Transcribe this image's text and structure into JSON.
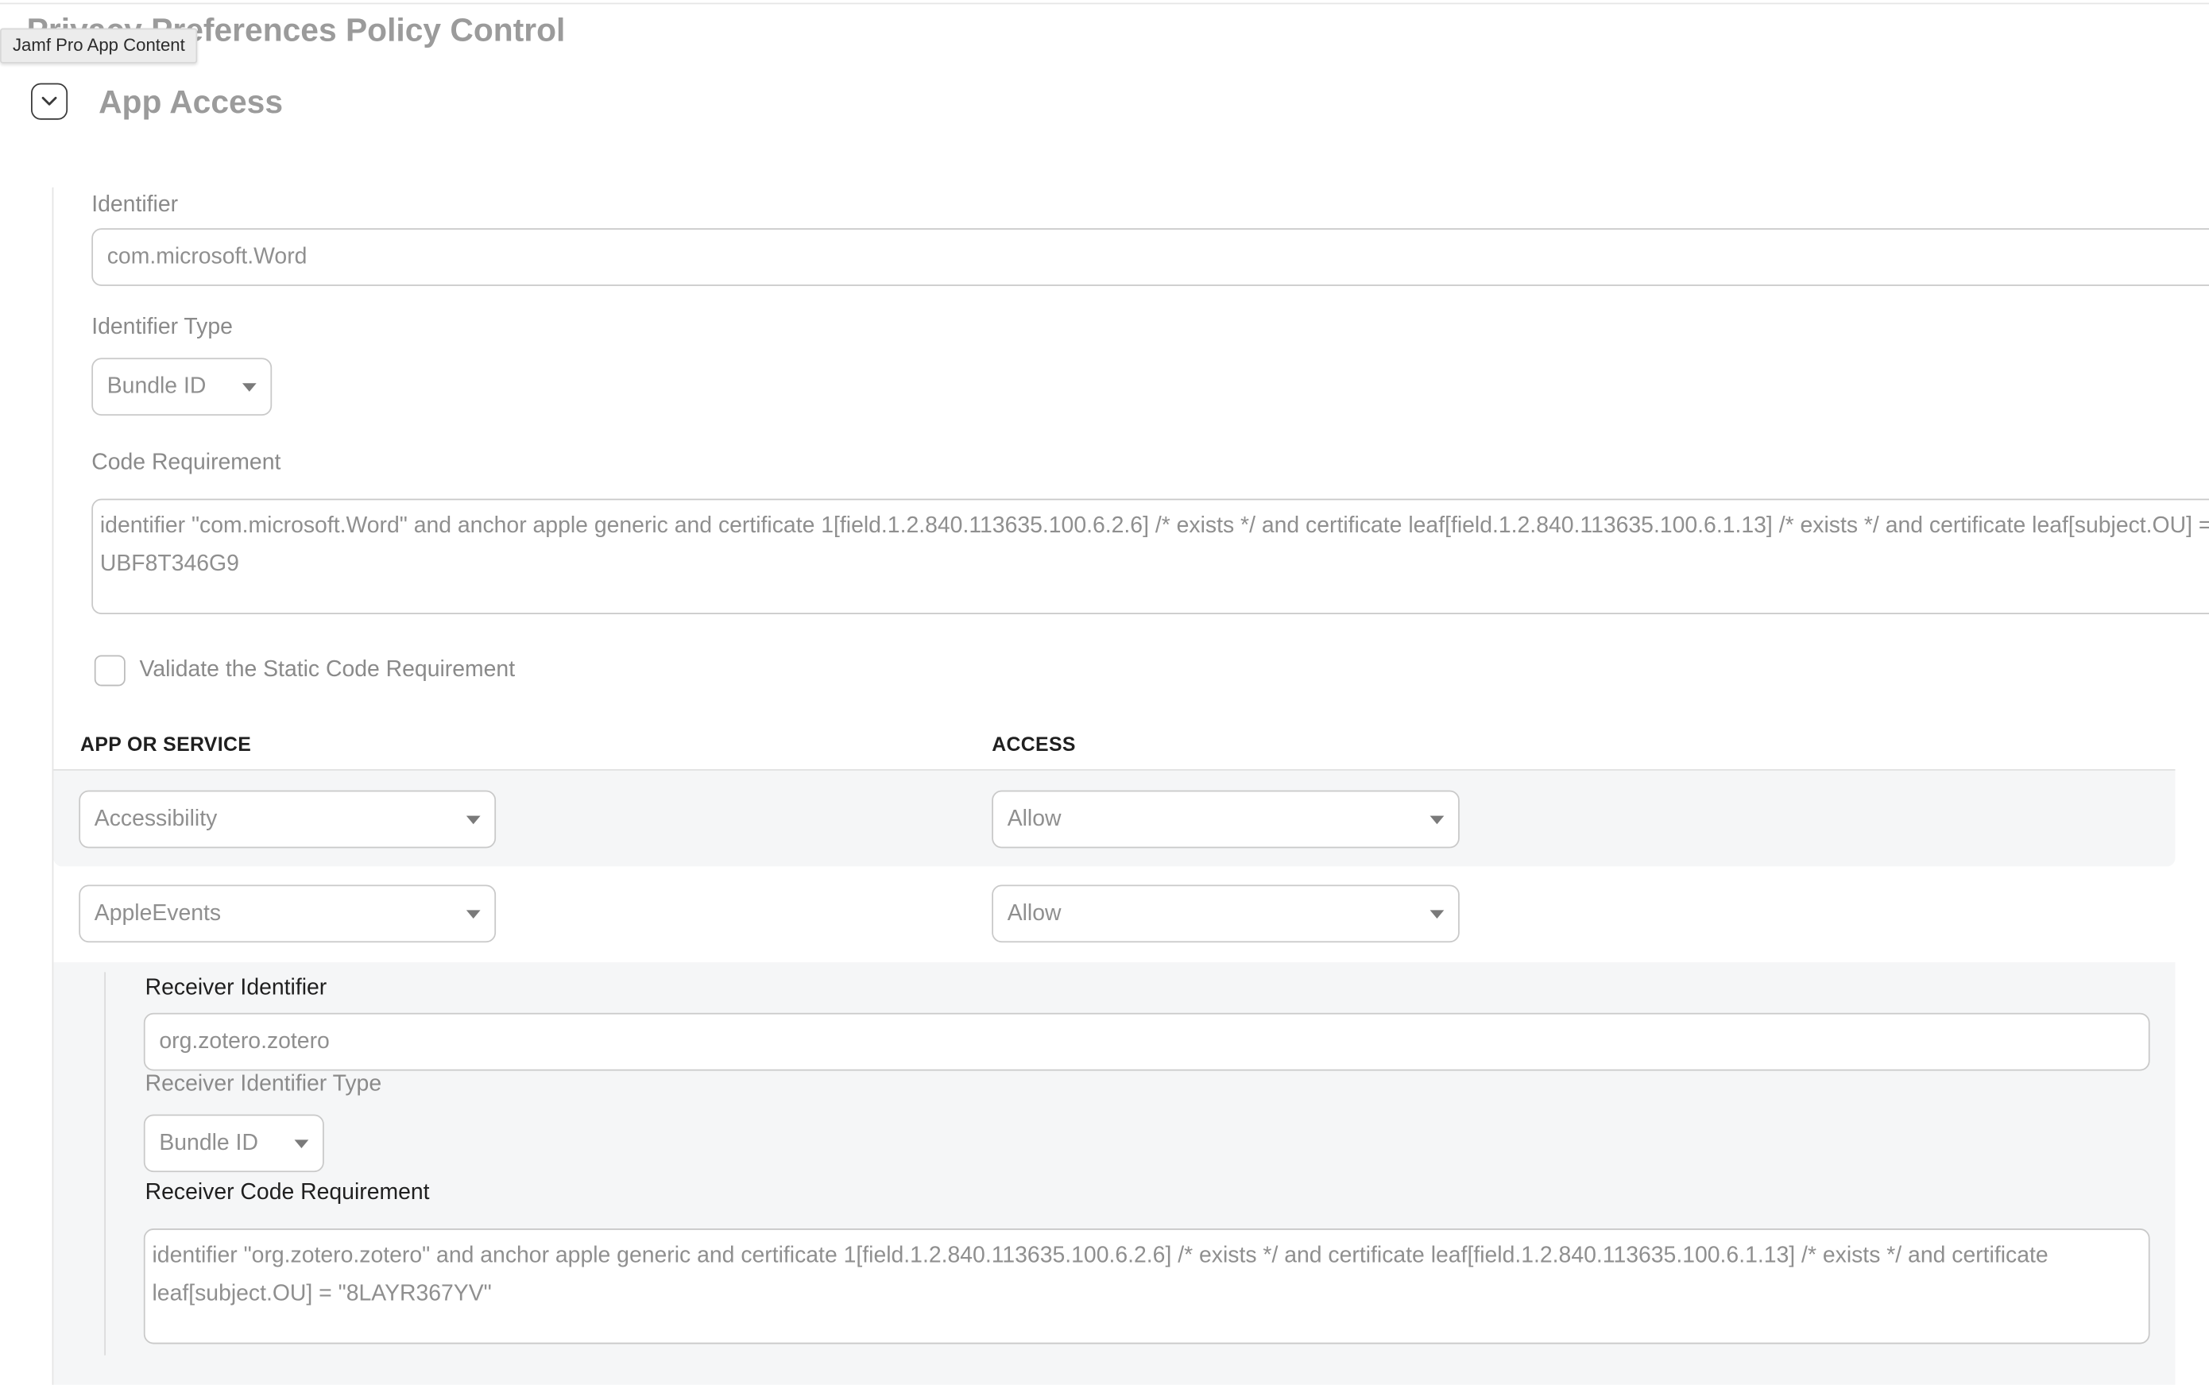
{
  "page": {
    "title": "Privacy Preferences Policy Control",
    "tooltip": "Jamf Pro App Content"
  },
  "section": {
    "title": "App Access",
    "collapse_icon": "chevron-down-icon"
  },
  "form": {
    "identifier_label": "Identifier",
    "identifier_value": "com.microsoft.Word",
    "identifier_type_label": "Identifier Type",
    "identifier_type_value": "Bundle ID",
    "code_requirement_label": "Code Requirement",
    "code_requirement_value": "identifier \"com.microsoft.Word\" and anchor apple generic and certificate 1[field.1.2.840.113635.100.6.2.6] /* exists */ and certificate leaf[field.1.2.840.113635.100.6.1.13] /* exists */ and certificate leaf[subject.OU] = UBF8T346G9",
    "validate_label": "Validate the Static Code Requirement",
    "validate_checked": false
  },
  "table": {
    "headers": [
      "APP OR SERVICE",
      "ACCESS"
    ],
    "rows": [
      {
        "service": "Accessibility",
        "access": "Allow"
      },
      {
        "service": "AppleEvents",
        "access": "Allow"
      }
    ]
  },
  "receiver": {
    "identifier_label": "Receiver Identifier",
    "identifier_value": "org.zotero.zotero",
    "identifier_type_label": "Receiver Identifier Type",
    "identifier_type_value": "Bundle ID",
    "code_requirement_label": "Receiver Code Requirement",
    "code_requirement_value": "identifier \"org.zotero.zotero\" and anchor apple generic and certificate 1[field.1.2.840.113635.100.6.2.6] /* exists */ and certificate leaf[field.1.2.840.113635.100.6.1.13] /* exists */ and certificate leaf[subject.OU] = \"8LAYR367YV\""
  },
  "colors": {
    "row_highlight": "#f5f6f7",
    "border": "#c9c9c9",
    "muted_text": "#8a8a8a",
    "dark_text": "#1f1f1f"
  }
}
